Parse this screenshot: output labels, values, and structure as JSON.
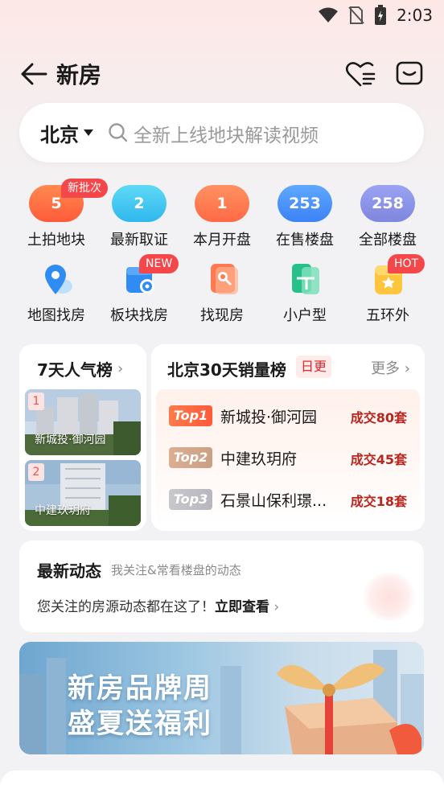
{
  "status_bar": {
    "time": "2:03"
  },
  "header": {
    "title": "新房"
  },
  "search": {
    "city": "北京",
    "placeholder": "全新上线地块解读视频"
  },
  "quick_stats": [
    {
      "count": "5",
      "label": "土拍地块",
      "badge": "新批次",
      "color": "#ff6a45"
    },
    {
      "count": "2",
      "label": "最新取证",
      "color": "#38bdf0"
    },
    {
      "count": "1",
      "label": "本月开盘",
      "color": "#ff7a52"
    },
    {
      "count": "253",
      "label": "在售楼盘",
      "color": "#3b82f6"
    },
    {
      "count": "258",
      "label": "全部楼盘",
      "color": "#8890e6"
    }
  ],
  "tools": [
    {
      "label": "地图找房",
      "icon": "map-pin-icon"
    },
    {
      "label": "板块找房",
      "icon": "district-map-icon",
      "badge": "NEW"
    },
    {
      "label": "找现房",
      "icon": "search-house-icon"
    },
    {
      "label": "小户型",
      "icon": "floorplan-icon"
    },
    {
      "label": "五环外",
      "icon": "star-box-icon",
      "badge": "HOT"
    }
  ],
  "popular": {
    "title": "7天人气榜",
    "items": [
      {
        "rank": "1",
        "name": "新城投·御河园"
      },
      {
        "rank": "2",
        "name": "中建玖玥府"
      }
    ]
  },
  "sales": {
    "title": "北京30天销量榜",
    "tag": "日更",
    "more": "更多",
    "items": [
      {
        "badge": "Top1",
        "name": "新城投·御河园",
        "deal": "成交80套"
      },
      {
        "badge": "Top2",
        "name": "中建玖玥府",
        "deal": "成交45套"
      },
      {
        "badge": "Top3",
        "name": "石景山保利璟...",
        "deal": "成交18套"
      }
    ]
  },
  "news": {
    "title": "最新动态",
    "subtitle": "我关注&常看楼盘的动态",
    "message": "您关注的房源动态都在这了！",
    "cta": "立即查看"
  },
  "banner": {
    "line1": "新房品牌周",
    "line2": "盛夏送福利"
  },
  "colors": {
    "accent": "#f5474a",
    "deal": "#b8261e"
  }
}
